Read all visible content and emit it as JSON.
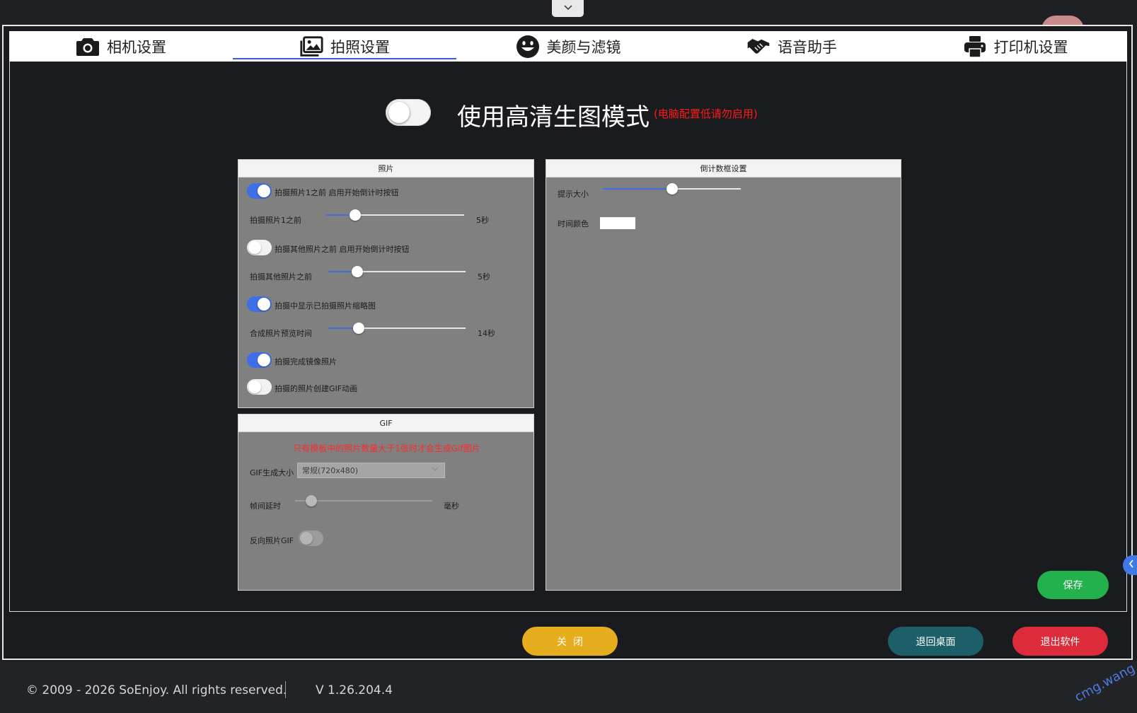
{
  "tabs": [
    {
      "label": "相机设置",
      "icon": "camera-icon"
    },
    {
      "label": "拍照设置",
      "icon": "photo-gallery-icon"
    },
    {
      "label": "美颜与滤镜",
      "icon": "smile-face-icon"
    },
    {
      "label": "语音助手",
      "icon": "handshake-icon"
    },
    {
      "label": "打印机设置",
      "icon": "printer-icon"
    }
  ],
  "active_tab": "拍照设置",
  "hd_mode": {
    "label": "使用高清生图模式",
    "note": "(电脑配置低请勿启用)",
    "enabled": false
  },
  "photo_panel": {
    "title": "照片",
    "countdown_first_toggle": {
      "label": "拍摄照片1之前 启用开始倒计时按钮",
      "on": true
    },
    "countdown_first_slider": {
      "label": "拍摄照片1之前",
      "value": 5,
      "value_text": "5秒",
      "fraction": 0.21
    },
    "countdown_other_toggle": {
      "label": "拍摄其他照片之前 启用开始倒计时按钮",
      "on": false
    },
    "countdown_other_slider": {
      "label": "拍摄其他照片之前",
      "value": 5,
      "value_text": "5秒",
      "fraction": 0.21
    },
    "show_thumbnails_toggle": {
      "label": "拍摄中显示已拍摄照片缩略图",
      "on": true
    },
    "preview_time_slider": {
      "label": "合成照片预览时间",
      "value": 14,
      "value_text": "14秒",
      "fraction": 0.22
    },
    "mirror_toggle": {
      "label": "拍摄完成镜像照片",
      "on": true
    },
    "gif_toggle": {
      "label": "拍摄的照片创建GIF动画",
      "on": false
    }
  },
  "gif_panel": {
    "title": "GIF",
    "warning": "只有模板中的照片数量大于1张时才会生成Gif图片",
    "size_label": "GIF生成大小",
    "size_value": "常规(720x480)",
    "frame_delay_label": "帧间延时",
    "frame_delay_unit": "毫秒",
    "frame_delay_fraction": 0.12,
    "reverse_label": "反向照片GIF",
    "reverse_on": false
  },
  "countdown_panel": {
    "title": "倒计数框设置",
    "size_label": "提示大小",
    "size_fraction": 0.5,
    "color_label": "时间颜色",
    "color_value": "#ffffff"
  },
  "buttons": {
    "save": "保存",
    "close": "关  闭",
    "back_desktop": "退回桌面",
    "exit": "退出软件"
  },
  "colors": {
    "save": "#22b14c",
    "close": "#e6ad1e",
    "back_desktop": "#1d5f68",
    "exit": "#dc2c3c",
    "accent": "#3f6ee8",
    "warning": "#ff1a1a"
  },
  "footer": {
    "copyright": "© 2009 - 2026 SoEnjoy. All rights reserved.",
    "version": "V 1.26.204.4",
    "watermark": "cmg.wang"
  }
}
